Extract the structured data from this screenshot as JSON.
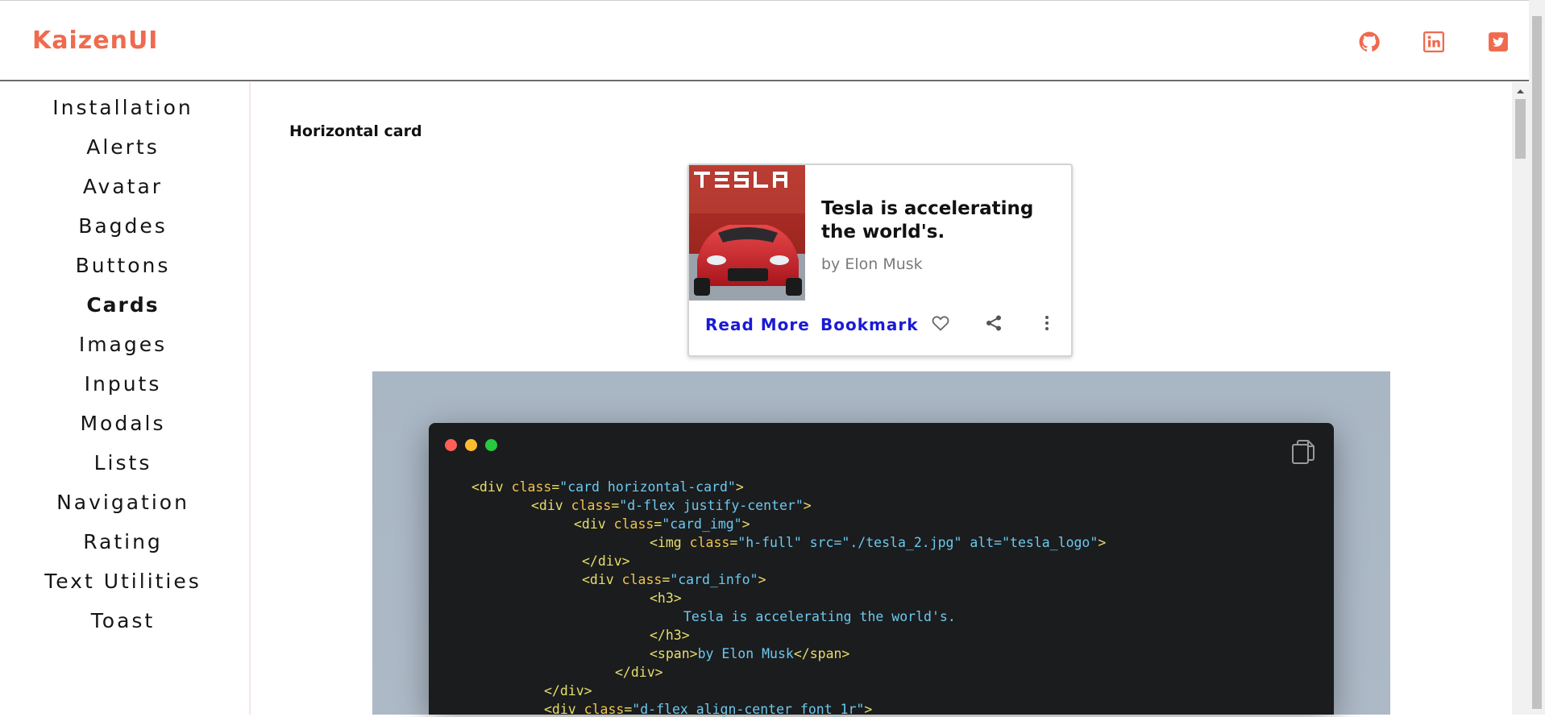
{
  "header": {
    "brand": "KaizenUI",
    "icons": [
      "github-icon",
      "linkedin-icon",
      "twitter-icon"
    ],
    "accent_color": "#f06a4e"
  },
  "sidebar": {
    "items": [
      {
        "label": "Installation"
      },
      {
        "label": "Alerts"
      },
      {
        "label": "Avatar"
      },
      {
        "label": "Bagdes"
      },
      {
        "label": "Buttons"
      },
      {
        "label": "Cards",
        "active": true
      },
      {
        "label": "Images"
      },
      {
        "label": "Inputs"
      },
      {
        "label": "Modals"
      },
      {
        "label": "Lists"
      },
      {
        "label": "Navigation"
      },
      {
        "label": "Rating"
      },
      {
        "label": "Text Utilities"
      },
      {
        "label": "Toast"
      }
    ]
  },
  "main": {
    "section_title": "Horizontal card",
    "card": {
      "image_text": "TESLA",
      "title": "Tesla is accelerating the world's.",
      "subtitle": "by Elon Musk",
      "read_more": "Read More",
      "bookmark": "Bookmark",
      "icons": [
        "heart-icon",
        "share-icon",
        "more-vertical-icon"
      ],
      "link_color": "#1a1ad6"
    },
    "code": {
      "window_dots": [
        "#ff5f56",
        "#ffbd2e",
        "#27c93f"
      ],
      "lines": [
        {
          "tag_open": "<div ",
          "attr": "class",
          "eq": "=",
          "str": "\"card horizontal-card\"",
          "tag_close": ">"
        },
        {
          "tag_open": "<div ",
          "attr": "class",
          "eq": "=",
          "str": "\"d-flex justify-center\"",
          "tag_close": ">"
        },
        {
          "tag_open": "<div ",
          "attr": "class",
          "eq": "=",
          "str": "\"card_img\"",
          "tag_close": ">"
        },
        {
          "tag_open": "<img ",
          "attr": "class",
          "eq": "=",
          "str": "\"h-full\" src=\"./tesla_2.jpg\" alt=\"tesla_logo\"",
          "tag_close": ">"
        },
        {
          "tag_open": "</div>",
          "attr": "",
          "eq": "",
          "str": "",
          "tag_close": ""
        },
        {
          "tag_open": "<div ",
          "attr": "class",
          "eq": "=",
          "str": "\"card_info\"",
          "tag_close": ">"
        },
        {
          "tag_open": "<h3>",
          "attr": "",
          "eq": "",
          "str": "",
          "tag_close": ""
        },
        {
          "tag_open": "",
          "attr": "",
          "eq": "",
          "str": "Tesla is accelerating the world's.",
          "tag_close": ""
        },
        {
          "tag_open": "</h3>",
          "attr": "",
          "eq": "",
          "str": "",
          "tag_close": ""
        },
        {
          "tag_open": "<span>",
          "attr": "",
          "eq": "",
          "str": "by Elon Musk",
          "tag_close": "</span>"
        },
        {
          "tag_open": "</div>",
          "attr": "",
          "eq": "",
          "str": "",
          "tag_close": ""
        },
        {
          "tag_open": "</div>",
          "attr": "",
          "eq": "",
          "str": "",
          "tag_close": ""
        },
        {
          "tag_open": "<div ",
          "attr": "class",
          "eq": "=",
          "str": "\"d-flex align-center font_1r\"",
          "tag_close": ">"
        }
      ]
    }
  }
}
